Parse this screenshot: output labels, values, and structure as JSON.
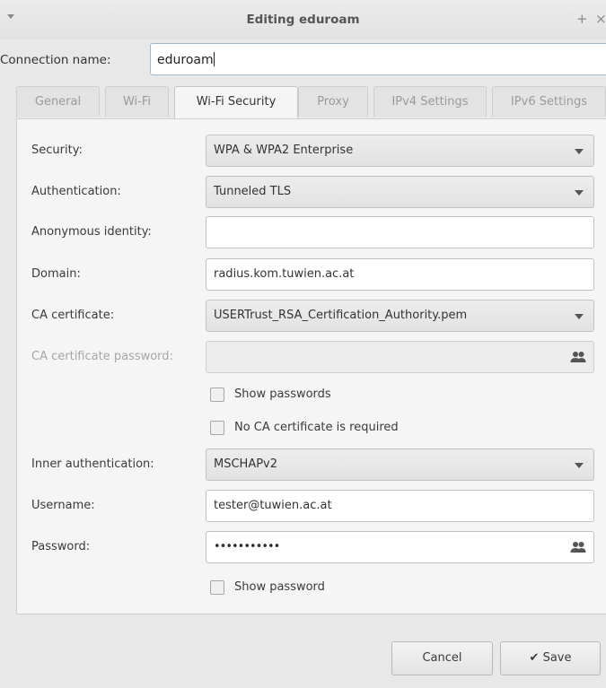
{
  "window": {
    "title": "Editing eduroam",
    "add_glyph": "+",
    "close_glyph": "×"
  },
  "connection": {
    "label": "Connection name:",
    "value": "eduroam"
  },
  "tabs": [
    {
      "label": "General",
      "active": false
    },
    {
      "label": "Wi-Fi",
      "active": false
    },
    {
      "label": "Wi-Fi Security",
      "active": true
    },
    {
      "label": "Proxy",
      "active": false
    },
    {
      "label": "IPv4 Settings",
      "active": false
    },
    {
      "label": "IPv6 Settings",
      "active": false
    }
  ],
  "form": {
    "security": {
      "label": "Security:",
      "value": "WPA & WPA2 Enterprise"
    },
    "authentication": {
      "label": "Authentication:",
      "value": "Tunneled TLS"
    },
    "anonymous_identity": {
      "label": "Anonymous identity:",
      "value": ""
    },
    "domain": {
      "label": "Domain:",
      "value": "radius.kom.tuwien.ac.at"
    },
    "ca_certificate": {
      "label": "CA certificate:",
      "value": "USERTrust_RSA_Certification_Authority.pem"
    },
    "ca_certificate_password": {
      "label": "CA certificate password:",
      "value": ""
    },
    "show_passwords": {
      "label": "Show passwords",
      "checked": false
    },
    "no_ca_required": {
      "label": "No CA certificate is required",
      "checked": false
    },
    "inner_authentication": {
      "label": "Inner authentication:",
      "value": "MSCHAPv2"
    },
    "username": {
      "label": "Username:",
      "value": "tester@tuwien.ac.at"
    },
    "password": {
      "label": "Password:",
      "value": "•••••••••••"
    },
    "show_password": {
      "label": "Show password",
      "checked": false
    }
  },
  "buttons": {
    "cancel": "Cancel",
    "save": "Save",
    "save_icon": "✔"
  },
  "icons": {
    "people": "users-icon"
  }
}
